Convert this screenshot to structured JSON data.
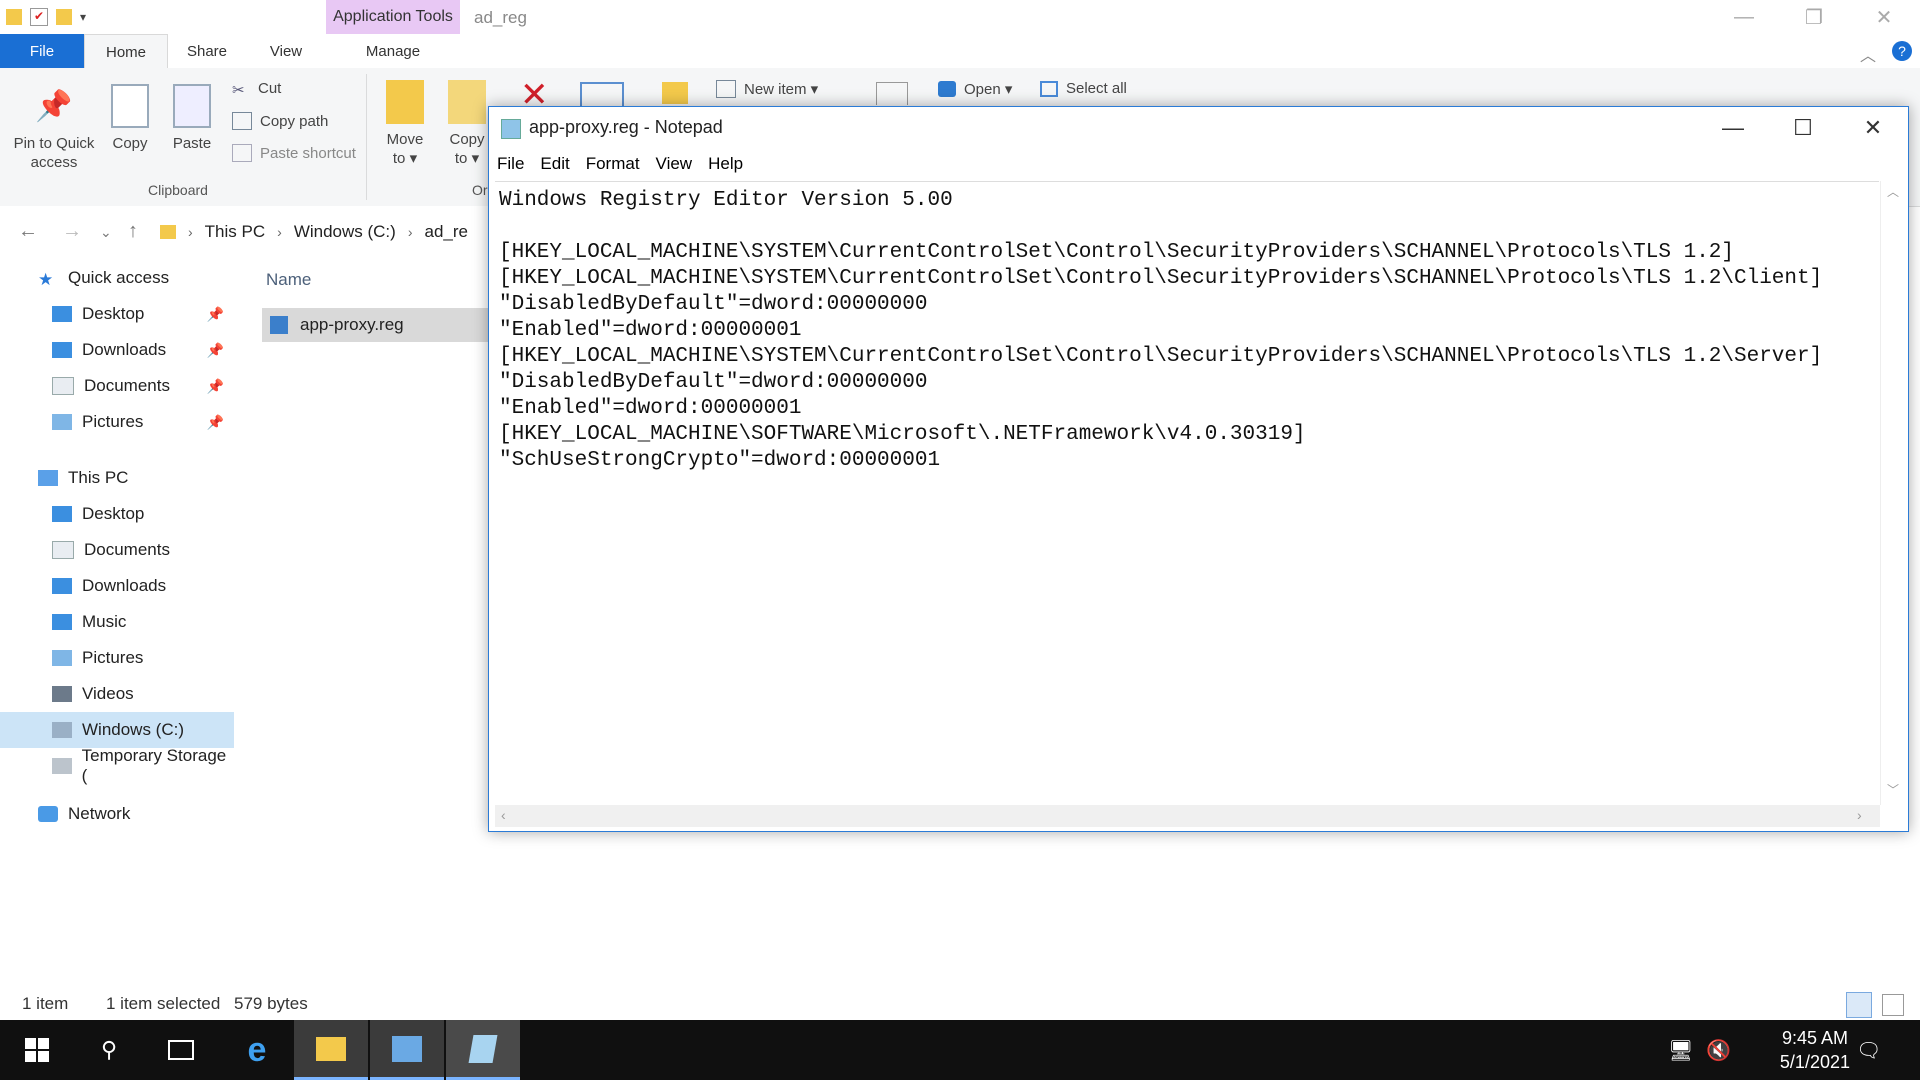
{
  "explorer": {
    "title": "ad_reg",
    "app_tools_tab": "Application Tools",
    "tabs": [
      "File",
      "Home",
      "Share",
      "View",
      "Manage"
    ],
    "ribbon": {
      "pin_to_quick_access": [
        "Pin to Quick",
        "access"
      ],
      "copy": "Copy",
      "paste": "Paste",
      "cut": "Cut",
      "copy_path": "Copy path",
      "paste_shortcut": "Paste shortcut",
      "clipboard_group": "Clipboard",
      "move_to": [
        "Move",
        "to ▾"
      ],
      "copy_to": [
        "Copy",
        "to ▾"
      ],
      "organize_group_partial": "Or",
      "new_item": "New item ▾",
      "open": "Open ▾",
      "select_all": "Select all"
    },
    "address": {
      "crumbs": [
        "This PC",
        "Windows (C:)",
        "ad_re"
      ]
    },
    "nav": {
      "quick_access": "Quick access",
      "qa_items": [
        "Desktop",
        "Downloads",
        "Documents",
        "Pictures"
      ],
      "this_pc": "This PC",
      "pc_items": [
        "Desktop",
        "Documents",
        "Downloads",
        "Music",
        "Pictures",
        "Videos",
        "Windows (C:)",
        "Temporary Storage ("
      ],
      "network": "Network"
    },
    "filelist": {
      "column_name": "Name",
      "file": "app-proxy.reg"
    },
    "status": {
      "count": "1 item",
      "selected": "1 item selected",
      "size": "579 bytes"
    }
  },
  "notepad": {
    "title": "app-proxy.reg - Notepad",
    "menu": [
      "File",
      "Edit",
      "Format",
      "View",
      "Help"
    ],
    "content": "Windows Registry Editor Version 5.00\n\n[HKEY_LOCAL_MACHINE\\SYSTEM\\CurrentControlSet\\Control\\SecurityProviders\\SCHANNEL\\Protocols\\TLS 1.2]\n[HKEY_LOCAL_MACHINE\\SYSTEM\\CurrentControlSet\\Control\\SecurityProviders\\SCHANNEL\\Protocols\\TLS 1.2\\Client]\n\"DisabledByDefault\"=dword:00000000\n\"Enabled\"=dword:00000001\n[HKEY_LOCAL_MACHINE\\SYSTEM\\CurrentControlSet\\Control\\SecurityProviders\\SCHANNEL\\Protocols\\TLS 1.2\\Server]\n\"DisabledByDefault\"=dword:00000000\n\"Enabled\"=dword:00000001\n[HKEY_LOCAL_MACHINE\\SOFTWARE\\Microsoft\\.NETFramework\\v4.0.30319]\n\"SchUseStrongCrypto\"=dword:00000001"
  },
  "taskbar": {
    "time": "9:45 AM",
    "date": "5/1/2021"
  },
  "colors": {
    "file_tab": "#1a6fd4",
    "app_tools": "#e8c8f4",
    "taskbar": "#101010",
    "selection": "#cce4f7"
  }
}
